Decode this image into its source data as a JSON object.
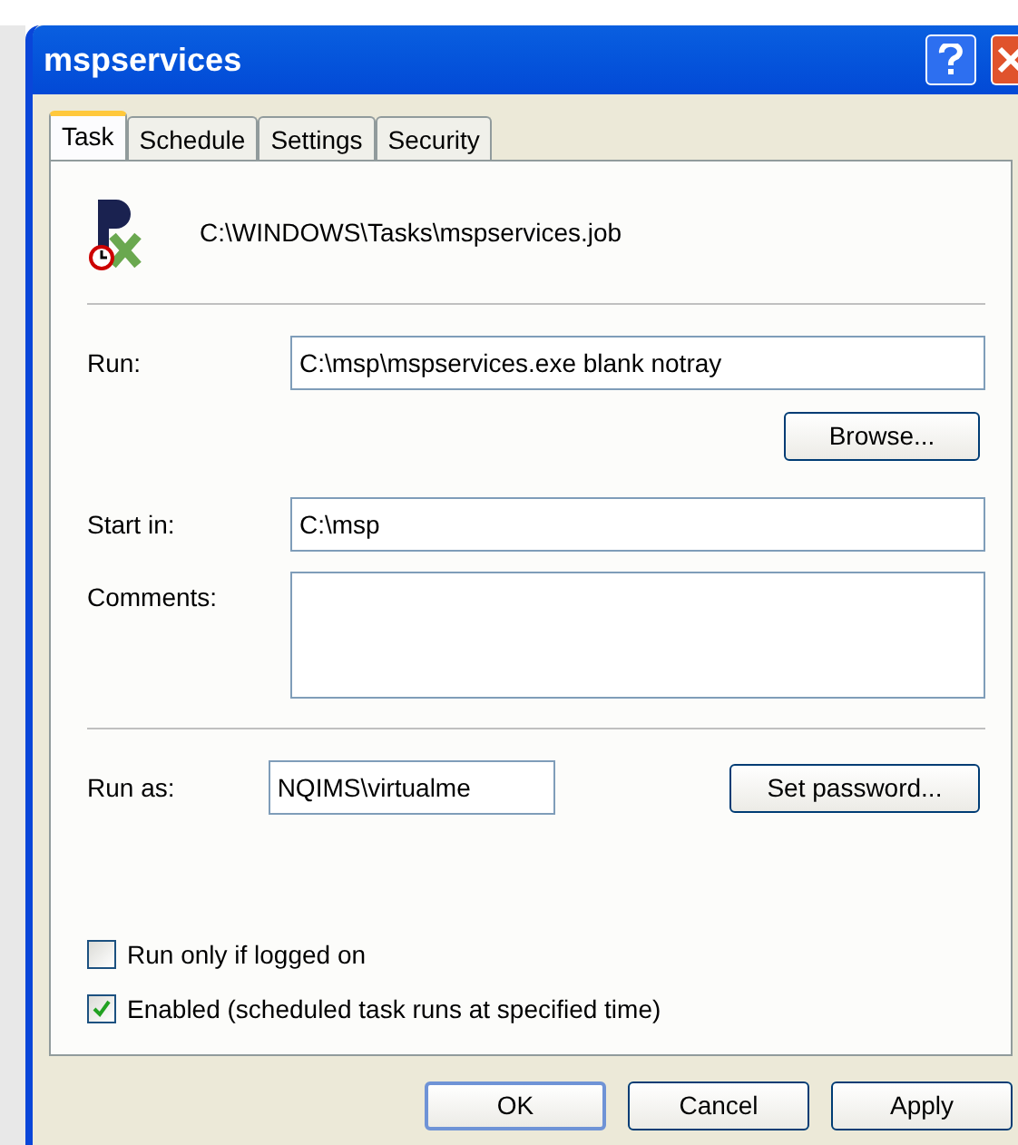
{
  "window": {
    "title": "mspservices"
  },
  "tabs": [
    {
      "label": "Task",
      "selected": true
    },
    {
      "label": "Schedule",
      "selected": false
    },
    {
      "label": "Settings",
      "selected": false
    },
    {
      "label": "Security",
      "selected": false
    }
  ],
  "task_file": "C:\\WINDOWS\\Tasks\\mspservices.job",
  "run": {
    "label": "Run:",
    "value": "C:\\msp\\mspservices.exe blank notray",
    "button": "Browse..."
  },
  "start_in": {
    "label": "Start in:",
    "value": "C:\\msp"
  },
  "comments": {
    "label": "Comments:"
  },
  "run_as": {
    "label": "Run as:",
    "value": "NQIMS\\virtualme",
    "button": "Set password..."
  },
  "checkboxes": [
    {
      "label": "Run only if logged on",
      "checked": false
    },
    {
      "label": "Enabled (scheduled task runs at specified time)",
      "checked": true
    }
  ],
  "buttons": [
    "OK",
    "Cancel",
    "Apply"
  ]
}
